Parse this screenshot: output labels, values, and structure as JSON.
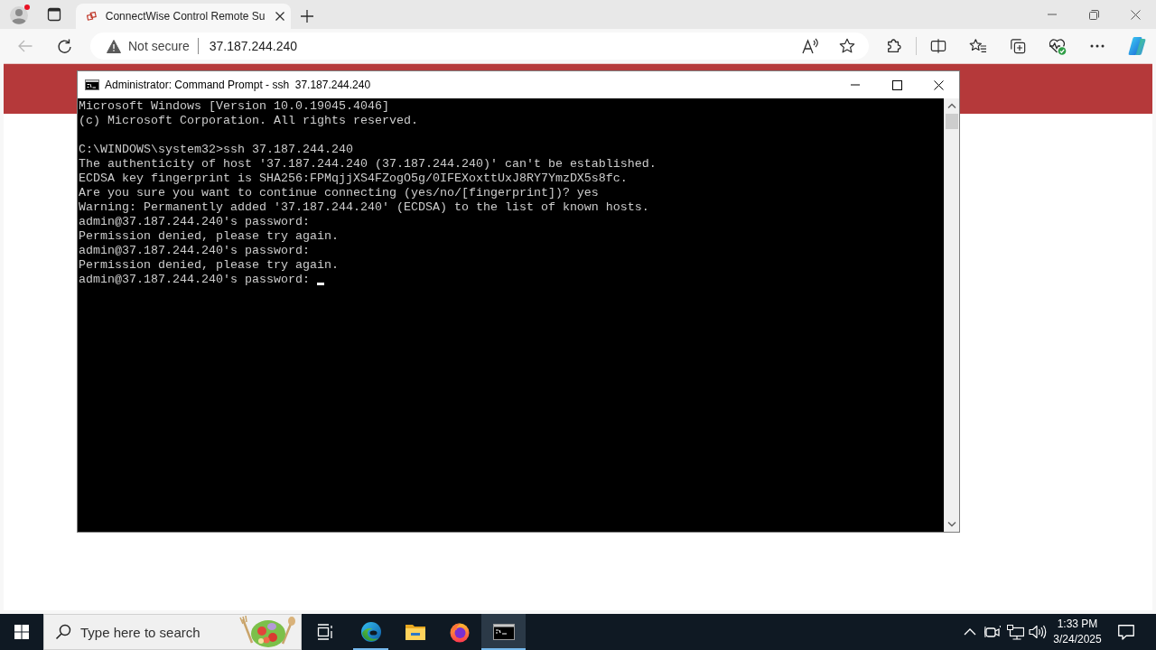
{
  "browser": {
    "profile": {
      "notification": true
    },
    "tabs": [
      {
        "title": "ConnectWise Control Remote Su",
        "selected": true
      }
    ],
    "back": {
      "disabled": true
    },
    "address_bar": {
      "security": "Not secure",
      "url": "37.187.244.240"
    }
  },
  "console_window": {
    "title": "Administrator: Command Prompt - ssh  37.187.244.240",
    "blocks": [
      {
        "lines": [
          "Microsoft Windows [Version 10.0.19045.4046]",
          "(c) Microsoft Corporation. All rights reserved."
        ]
      },
      {
        "lines": [
          "C:\\WINDOWS\\system32>ssh 37.187.244.240",
          "The authenticity of host '37.187.244.240 (37.187.244.240)' can't be established.",
          "ECDSA key fingerprint is SHA256:FPMqjjXS4FZogO5g/0IFEXoxttUxJ8RY7YmzDX5s8fc.",
          "Are you sure you want to continue connecting (yes/no/[fingerprint])? yes",
          "Warning: Permanently added '37.187.244.240' (ECDSA) to the list of known hosts.",
          "admin@37.187.244.240's password:",
          "Permission denied, please try again.",
          "admin@37.187.244.240's password:",
          "Permission denied, please try again.",
          "admin@37.187.244.240's password:"
        ]
      }
    ]
  },
  "taskbar": {
    "search": {
      "placeholder": "Type here to search"
    },
    "apps": [
      {
        "kind": "edge",
        "running": true,
        "selected": false
      },
      {
        "kind": "explorer",
        "running": false,
        "selected": false
      },
      {
        "kind": "firefox",
        "running": false,
        "selected": false
      },
      {
        "kind": "terminal",
        "running": true,
        "selected": true
      }
    ],
    "clock": {
      "time": "1:33 PM",
      "date": "3/24/2025"
    }
  }
}
